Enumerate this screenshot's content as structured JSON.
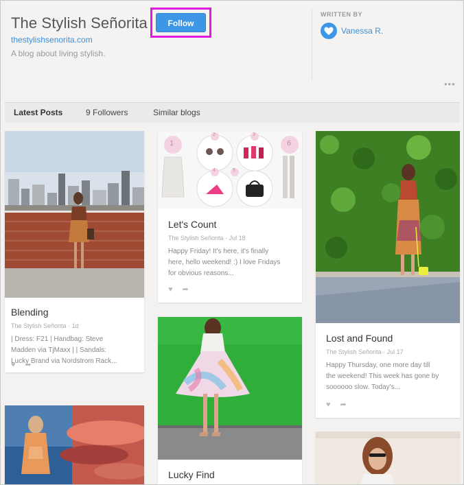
{
  "header": {
    "title": "The Stylish Señorita",
    "follow_label": "Follow",
    "url": "thestylishsenorita.com",
    "description": "A blog about living stylish.",
    "written_by_label": "WRITTEN BY",
    "author": "Vanessa R.",
    "more_icon": "more-dots-icon",
    "accent_color": "#3d97e6",
    "highlight_color": "#e11adf"
  },
  "tabs": [
    "Latest Posts",
    "9 Followers",
    "Similar blogs"
  ],
  "posts": [
    {
      "title": "Blending",
      "author": "The Stylish Señorita",
      "date": "1d",
      "excerpt": "| Dress: F21 | Handbag: Steve\nMadden via TjMaxx | | Sandals:\nLucky Brand via Nordstrom Rack..."
    },
    {
      "title": "Let's Count",
      "author": "The Stylish Señorita",
      "date": "Jul 18",
      "excerpt": "Happy Friday! It's here, it's finally\nhere, hello weekend! :) I love Fridays\nfor obvious reasons..."
    },
    {
      "title": "Lost and Found",
      "author": "The Stylish Señorita",
      "date": "Jul 17",
      "excerpt": "Happy Thursday, one more day till\nthe weekend! This week has gone by\nsoooooo slow. Today's..."
    },
    {
      "title": "Lucky Find"
    }
  ],
  "collage_numbers": [
    "1",
    "2",
    "3",
    "4",
    "5",
    "6"
  ],
  "meta_separator": "·",
  "actions": {
    "like_icon": "heart-icon",
    "share_icon": "share-arrow-icon",
    "like_glyph": "♥",
    "share_glyph": "➦"
  }
}
